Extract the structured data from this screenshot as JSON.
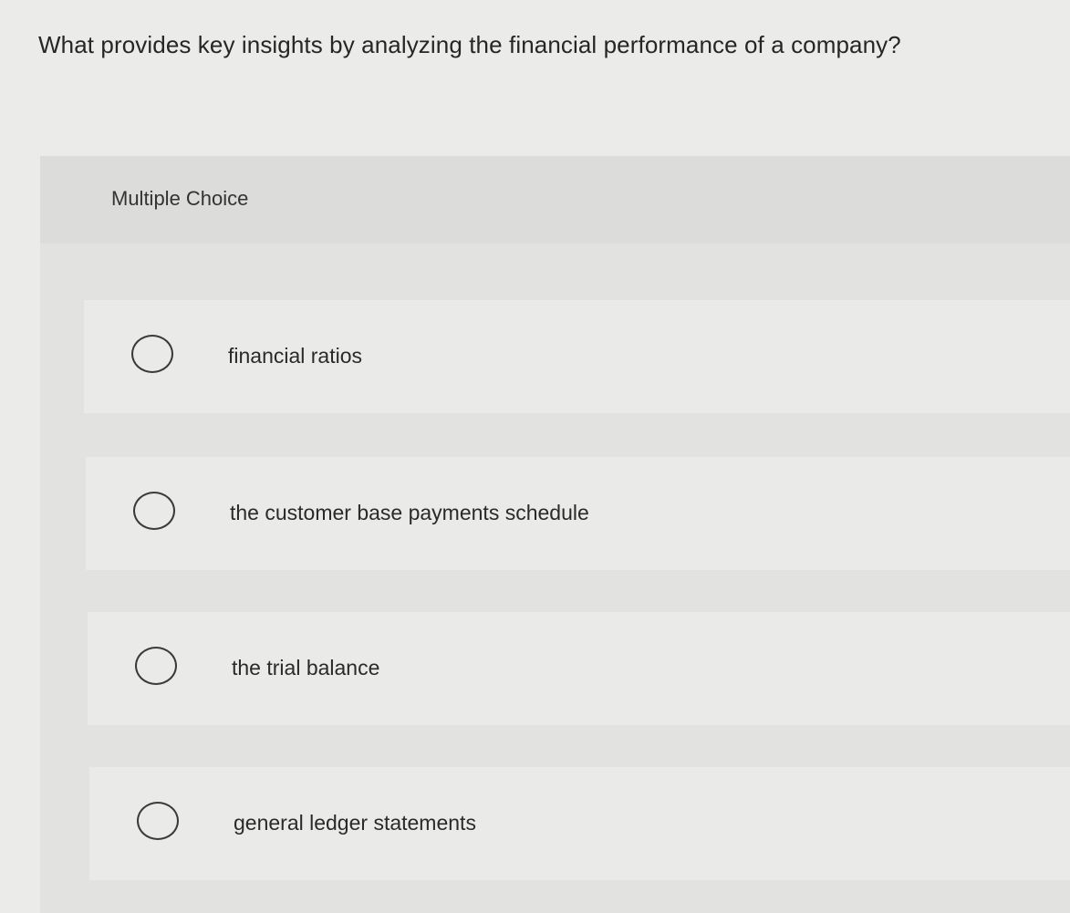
{
  "question": {
    "text": "What provides key insights by analyzing the financial performance of a company?"
  },
  "multiple_choice": {
    "title": "Multiple Choice",
    "options": [
      {
        "label": "financial ratios",
        "selected": false
      },
      {
        "label": "the customer base payments schedule",
        "selected": false
      },
      {
        "label": "the trial balance",
        "selected": false
      },
      {
        "label": "general ledger statements",
        "selected": false
      }
    ]
  }
}
